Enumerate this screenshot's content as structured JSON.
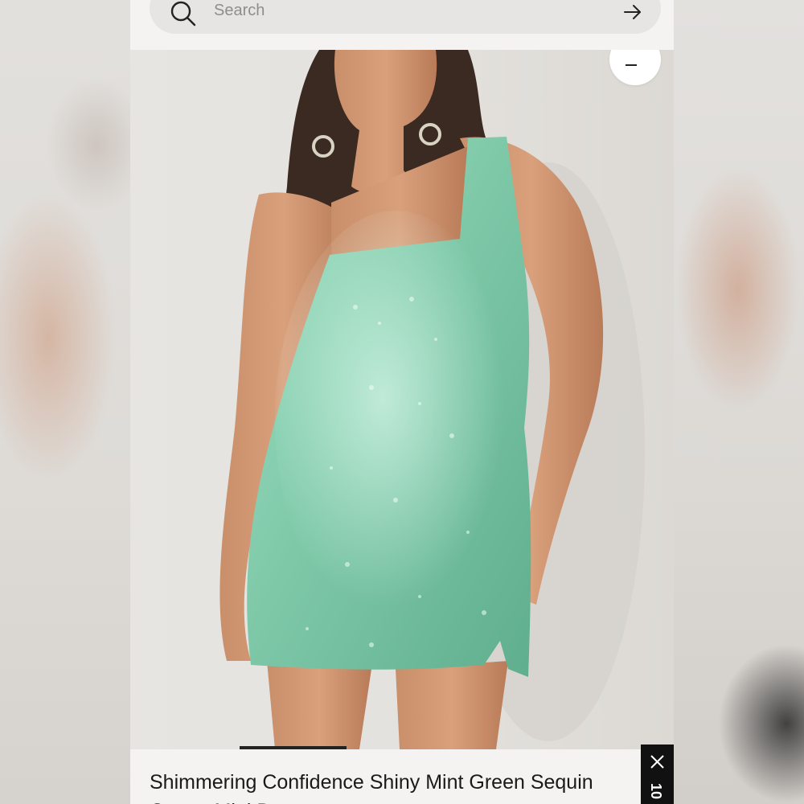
{
  "search": {
    "placeholder": "Search"
  },
  "icons": {
    "search": "search-icon",
    "submit": "arrow-right-icon",
    "zoom": "zoom-out-icon",
    "close": "close-icon"
  },
  "product": {
    "image_alt": "Woman wearing a mint green sequin cutout mini dress",
    "title": "Shimmering Confidence Shiny Mint Green Sequin Cutout Mini Dress"
  },
  "gallery": {
    "progress": 0.33
  },
  "popup": {
    "tab_label": "10"
  },
  "colors": {
    "dress": "#8fd3b6",
    "background": "#f4f3f1",
    "accent": "#111111"
  }
}
